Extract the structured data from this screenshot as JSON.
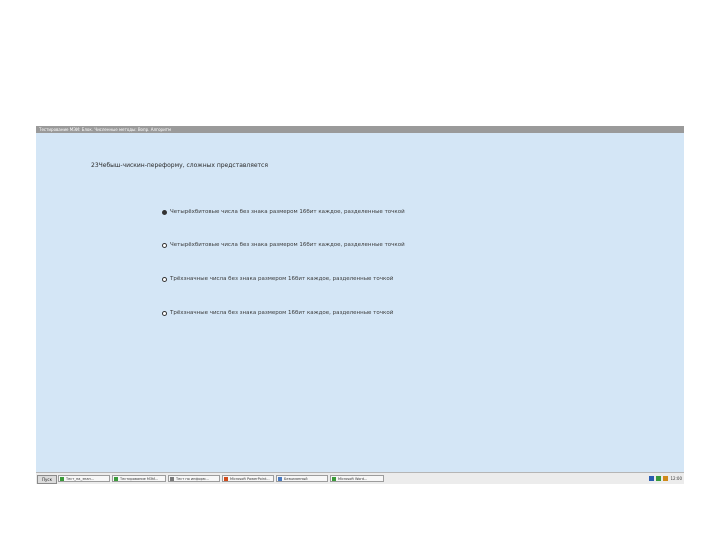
{
  "window": {
    "title": "Тестирование МЭИ: Блок. Численные методы: Вопр. Алгоритм"
  },
  "question": {
    "text": "23Чебыш-чискин-переформу, сложных представляется"
  },
  "options": [
    {
      "label": "Четырёхбитовые числа без знака размером 16бит каждое, разделенные точкой",
      "selected": true
    },
    {
      "label": "Четырёхбитовые числа без знака размером 16бит каждое, разделенные точкой",
      "selected": false
    },
    {
      "label": "Трёхзначные числа без знака размером 16бит каждое, разделенные точкой",
      "selected": false
    },
    {
      "label": "Трёхзначные числа без знака размером 16бит каждое, разделенные точкой",
      "selected": false
    }
  ],
  "taskbar": {
    "start_label": "Пуск",
    "tasks": [
      {
        "label": "Тест_на_знан...",
        "icon": "green-app-icon",
        "color": "#3a9a3a"
      },
      {
        "label": "Тестирование МЭИ...",
        "icon": "green-app-icon",
        "color": "#3a9a3a"
      },
      {
        "label": "Тест по информ...",
        "icon": "document-icon",
        "color": "#7a7a7a"
      },
      {
        "label": "Microsoft PowerPoint...",
        "icon": "powerpoint-icon",
        "color": "#d04a1a"
      },
      {
        "label": "Безымянный",
        "icon": "folder-icon",
        "color": "#4a7ac0"
      },
      {
        "label": "Microsoft Word...",
        "icon": "green-app-icon",
        "color": "#3a9a3a"
      }
    ],
    "clock": "12:00",
    "tray_colors": [
      "#2a5cb0",
      "#3a9a3a",
      "#d08a1a"
    ]
  },
  "colors": {
    "background": "#d4e6f6",
    "titlebar": "#9a9a9a"
  }
}
